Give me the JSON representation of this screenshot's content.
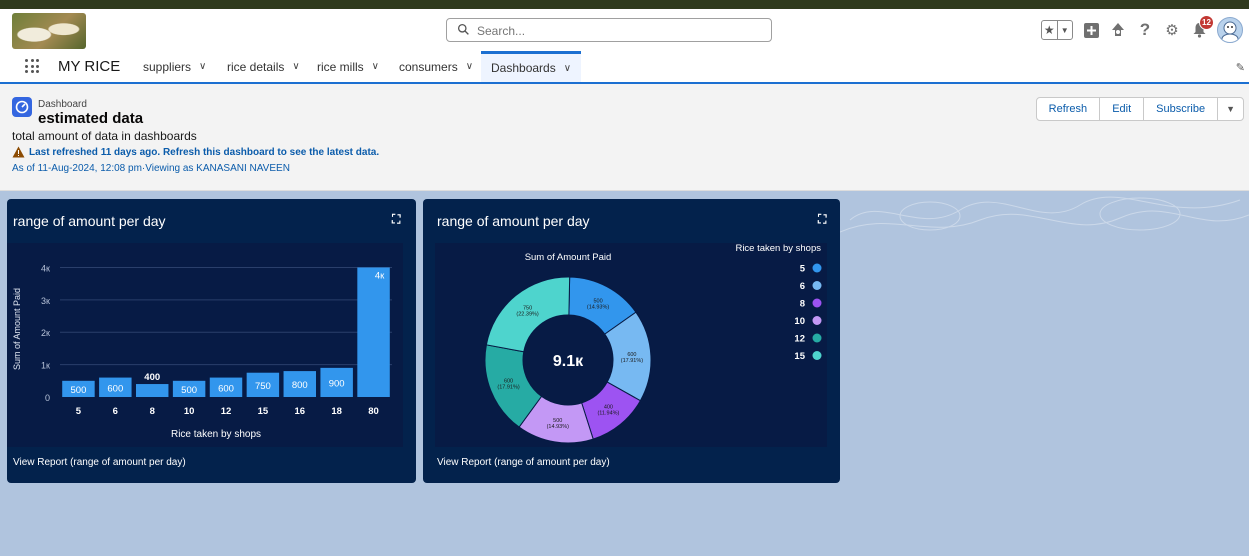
{
  "header": {
    "search_placeholder": "Search...",
    "notification_count": "12",
    "icons": [
      "favorites-star-icon",
      "add-icon",
      "setup-assistant-icon",
      "help-icon",
      "gear-icon",
      "notification-bell-icon",
      "avatar"
    ]
  },
  "nav": {
    "app_name": "MY RICE",
    "tabs": [
      {
        "label": "suppliers"
      },
      {
        "label": "rice details"
      },
      {
        "label": "rice mills"
      },
      {
        "label": "consumers"
      },
      {
        "label": "Dashboards"
      }
    ],
    "active_tab": "Dashboards"
  },
  "dashboard": {
    "label": "Dashboard",
    "title": "estimated data",
    "description": "total amount of data in dashboards",
    "warning": "Last refreshed 11 days ago. Refresh this dashboard to see the latest data.",
    "as_of": "As of 11-Aug-2024, 12:08 pm·Viewing as KANASANI NAVEEN",
    "buttons": {
      "refresh": "Refresh",
      "edit": "Edit",
      "subscribe": "Subscribe"
    }
  },
  "widget1": {
    "title": "range of amount per day",
    "footer": "View Report (range of amount per day)"
  },
  "widget2": {
    "title": "range of amount per day",
    "footer": "View Report (range of amount per day)"
  },
  "chart_data": [
    {
      "type": "bar",
      "title": "",
      "xlabel": "Rice taken by shops",
      "ylabel": "Sum of Amount Paid",
      "categories": [
        "5",
        "6",
        "8",
        "10",
        "12",
        "15",
        "16",
        "18",
        "80"
      ],
      "values": [
        500,
        600,
        400,
        500,
        600,
        750,
        800,
        900,
        4000
      ],
      "data_labels": [
        "500",
        "600",
        "400",
        "500",
        "600",
        "750",
        "800",
        "900",
        "4к"
      ],
      "yticks": [
        "0",
        "1к",
        "2к",
        "3к",
        "4к"
      ],
      "ylim": [
        0,
        4200
      ],
      "grid": true,
      "color": "#3296ed"
    },
    {
      "type": "pie",
      "donut": true,
      "subtitle": "Sum of Amount Paid",
      "center_label": "9.1к",
      "legend_title": "Rice taken by shops",
      "legend_position": "top-right",
      "slices": [
        {
          "label": "5",
          "value": 500,
          "text": "500",
          "pct": "(14.93%)",
          "color": "#3296ed"
        },
        {
          "label": "6",
          "value": 600,
          "text": "600",
          "pct": "(17.91%)",
          "color": "#77b9f2"
        },
        {
          "label": "8",
          "value": 400,
          "text": "400",
          "pct": "(11.94%)",
          "color": "#9d53f2"
        },
        {
          "label": "10",
          "value": 500,
          "text": "500",
          "pct": "(14.93%)",
          "color": "#c398f5"
        },
        {
          "label": "12",
          "value": 600,
          "text": "600",
          "pct": "(17.91%)",
          "color": "#26aba4"
        },
        {
          "label": "15",
          "value": 750,
          "text": "750",
          "pct": "(22.39%)",
          "color": "#4ed4cd"
        }
      ]
    }
  ]
}
